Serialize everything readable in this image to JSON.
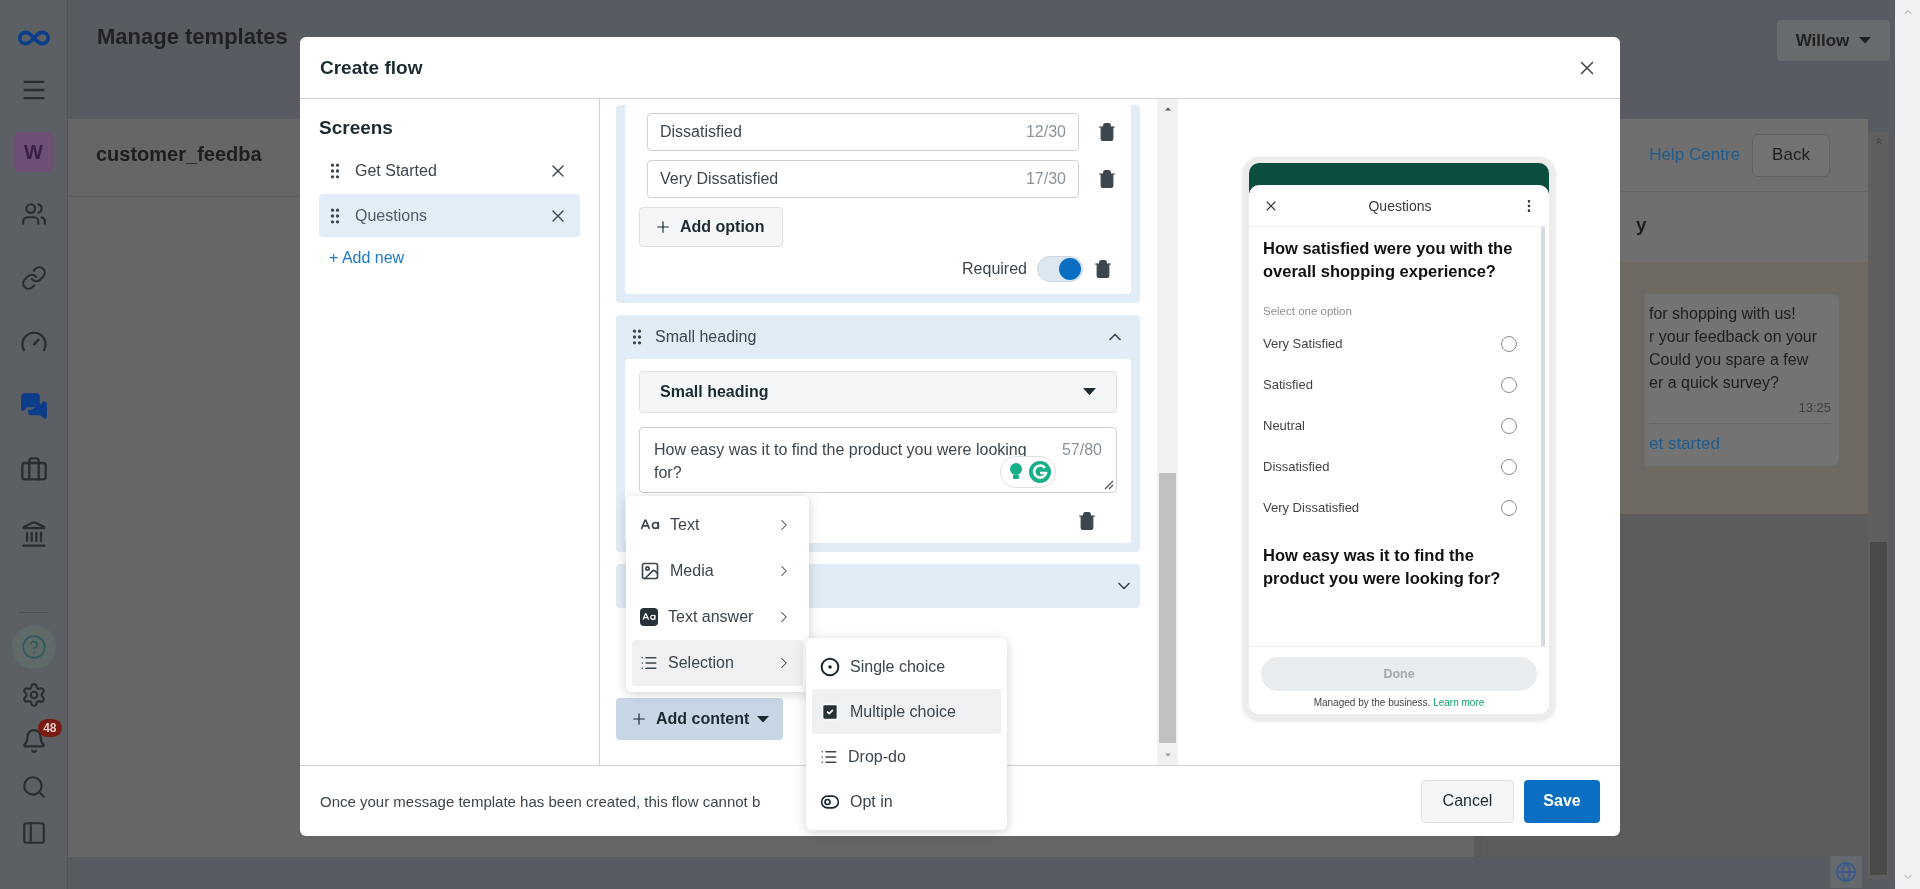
{
  "rail": {
    "items": [
      {
        "kind": "people",
        "selected": false
      },
      {
        "kind": "link",
        "selected": false
      },
      {
        "kind": "gauge",
        "selected": false
      },
      {
        "kind": "chat",
        "selected": true
      },
      {
        "kind": "briefcase",
        "selected": false
      },
      {
        "kind": "bank",
        "selected": false
      }
    ],
    "avatar": "W",
    "notification_badge": "48"
  },
  "page": {
    "title": "Manage templates",
    "account_menu": "Willow",
    "template_card": {
      "title": "customer_feedba"
    },
    "preview_panel": {
      "help_link": "Help Centre",
      "back_button": "Back",
      "heading": "y",
      "message": {
        "text": "for shopping with us!\nr your feedback on your\nCould you spare a few\ner a quick survey?",
        "time": "13:25",
        "button": "et started"
      }
    }
  },
  "modal": {
    "title": "Create flow",
    "screens": {
      "heading": "Screens",
      "items": [
        {
          "label": "Get Started",
          "selected": false
        },
        {
          "label": "Questions",
          "selected": true
        }
      ],
      "add_new": "+ Add new"
    },
    "editor": {
      "options": [
        {
          "value": "Dissatisfied",
          "count": "12/30"
        },
        {
          "value": "Very Dissatisfied",
          "count": "17/30"
        }
      ],
      "add_option": "Add option",
      "required": {
        "label": "Required",
        "on": true
      },
      "heading_block": {
        "title": "Small heading",
        "expanded": true,
        "type_select": "Small heading",
        "text": {
          "value": "How easy was it to find the product you were looking for?",
          "count": "57/80"
        }
      },
      "collapsed_block": {
        "expanded": false
      },
      "add_content": "Add content"
    },
    "content_menu": {
      "items": [
        {
          "label": "Text",
          "kind": "text",
          "selected": false
        },
        {
          "label": "Media",
          "kind": "media",
          "selected": false
        },
        {
          "label": "Text answer",
          "kind": "text_answer",
          "selected": false
        },
        {
          "label": "Selection",
          "kind": "selection",
          "selected": true
        }
      ]
    },
    "selection_submenu": {
      "items": [
        {
          "label": "Single choice",
          "kind": "radio",
          "selected": false
        },
        {
          "label": "Multiple choice",
          "kind": "checkbox",
          "selected": true
        },
        {
          "label": "Drop-do",
          "kind": "list",
          "selected": false
        },
        {
          "label": "Opt in",
          "kind": "toggle",
          "selected": false
        }
      ]
    },
    "preview": {
      "title": "Questions",
      "question": "How satisfied were you with the overall shopping experience?",
      "hint": "Select one option",
      "options": [
        {
          "label": "Very Satisfied",
          "selected": false
        },
        {
          "label": "Satisfied",
          "selected": false
        },
        {
          "label": "Neutral",
          "selected": false
        },
        {
          "label": "Dissatisfied",
          "selected": false
        },
        {
          "label": "Very Dissatisfied",
          "selected": false
        }
      ],
      "next_question": "How easy was it to find the product you were looking for?",
      "done_button": {
        "label": "Done",
        "disabled": true
      },
      "footer": {
        "text": "Managed by the business.",
        "link": "Learn more"
      }
    },
    "footer": {
      "note": "Once your message template has been created, this flow cannot b",
      "cancel": "Cancel",
      "save": "Save"
    }
  }
}
